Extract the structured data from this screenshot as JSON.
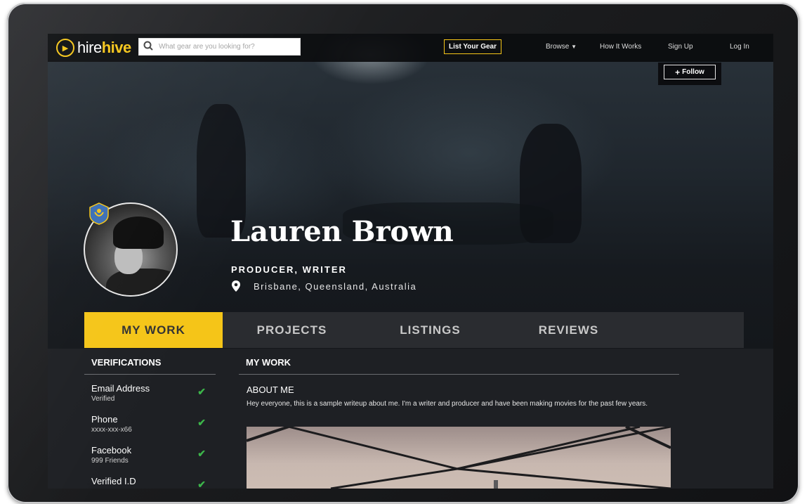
{
  "brand": {
    "name_left": "hire",
    "name_right": "hive"
  },
  "search": {
    "placeholder": "What gear are you looking for?"
  },
  "header": {
    "list_gear": "List Your Gear",
    "nav": {
      "browse": "Browse",
      "how_it_works": "How It Works",
      "sign_up": "Sign Up",
      "log_in": "Log In"
    },
    "follow": "Follow"
  },
  "profile": {
    "name": "Lauren Brown",
    "role": "PRODUCER, WRITER",
    "location": "Brisbane, Queensland, Australia"
  },
  "tabs": [
    {
      "label": "MY WORK",
      "active": true
    },
    {
      "label": "PROJECTS",
      "active": false
    },
    {
      "label": "LISTINGS",
      "active": false
    },
    {
      "label": "REVIEWS",
      "active": false
    }
  ],
  "verifications": {
    "title": "VERIFICATIONS",
    "items": [
      {
        "label": "Email Address",
        "sub": "Verified"
      },
      {
        "label": "Phone",
        "sub": "xxxx-xxx-x66"
      },
      {
        "label": "Facebook",
        "sub": "999 Friends"
      },
      {
        "label": "Verified I.D",
        "sub": ""
      }
    ]
  },
  "my_work": {
    "title": "MY WORK",
    "about_title": "ABOUT ME",
    "about_text": "Hey everyone, this is a sample writeup about me. I'm a writer and producer and have been making movies for the past few years."
  },
  "colors": {
    "accent": "#f5c518",
    "check": "#3cb54a",
    "panel": "#1e2024"
  }
}
